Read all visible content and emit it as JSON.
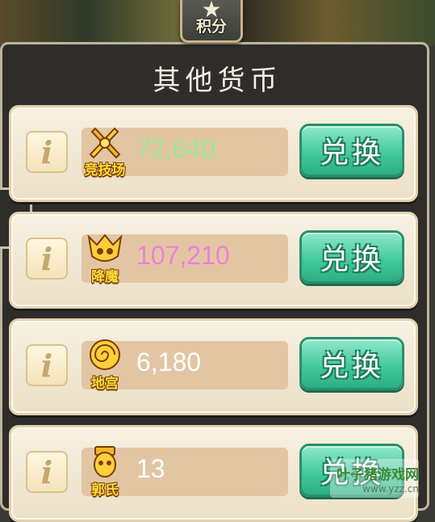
{
  "header": {
    "tab_label": "积分",
    "title": "其他货币"
  },
  "rows": [
    {
      "coin_icon": "crossed-swords-icon",
      "coin_label": "竞技场",
      "value": "72,640",
      "value_color": "#9ee59b",
      "exchange_label": "兑换"
    },
    {
      "coin_icon": "demon-mask-icon",
      "coin_label": "降魔",
      "value": "107,210",
      "value_color": "#ef7fd9",
      "exchange_label": "兑换"
    },
    {
      "coin_icon": "spiral-scroll-icon",
      "coin_label": "地宫",
      "value": "6,180",
      "value_color": "#ffffff",
      "exchange_label": "兑换"
    },
    {
      "coin_icon": "general-head-icon",
      "coin_label": "郭氏",
      "value": "13",
      "value_color": "#ffffff",
      "exchange_label": "兑换"
    }
  ],
  "info_label": "i",
  "watermark": {
    "line1": "叶子猪游戏网",
    "line2": "www.yzz.cn"
  },
  "colors": {
    "panel_bg": "#2e2d2a",
    "row_bg": "#f5eedd",
    "button_green": "#3fc79a",
    "value_box": "#e2c6a4"
  }
}
